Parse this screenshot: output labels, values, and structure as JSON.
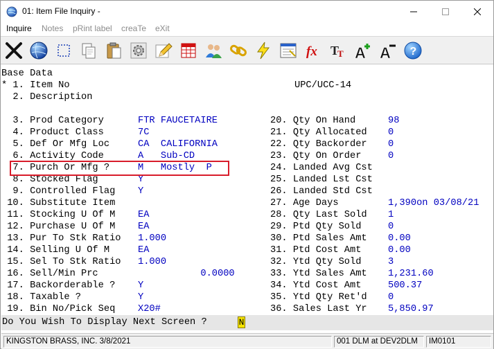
{
  "window": {
    "title": "01: Item File Inquiry -"
  },
  "menu": [
    {
      "label": "Inquire",
      "enabled": true
    },
    {
      "label": "Notes",
      "enabled": false
    },
    {
      "label": "pRint label",
      "enabled": false
    },
    {
      "label": "creaTe",
      "enabled": false
    },
    {
      "label": "eXit",
      "enabled": false
    }
  ],
  "toolbar": [
    "cancel-x-icon",
    "globe-icon",
    "select-rectangle-icon",
    "copy-pages-icon",
    "clipboard-icon",
    "gear-icon",
    "pencil-edit-icon",
    "spreadsheet-icon",
    "users-icon",
    "chain-link-icon",
    "lightning-icon",
    "calculator-window-icon",
    "fx-formula-icon",
    "font-size-icon",
    "increase-font-icon",
    "decrease-font-icon",
    "help-icon"
  ],
  "terminal": {
    "section_title": "Base Data",
    "left_fields": [
      {
        "label": "* 1. Item No",
        "value": ""
      },
      {
        "label": "  2. Description",
        "value": ""
      },
      {
        "label": "",
        "value": ""
      },
      {
        "label": "  3. Prod Category",
        "value": "FTR FAUCETAIRE"
      },
      {
        "label": "  4. Product Class",
        "value": "7C"
      },
      {
        "label": "  5. Def Or Mfg Loc",
        "value": "CA  CALIFORNIA"
      },
      {
        "label": "  6. Activity Code",
        "value": "A   Sub-CD"
      },
      {
        "label": "  7. Purch Or Mfg ?",
        "value": "M   Mostly  P"
      },
      {
        "label": "  8. Stocked Flag",
        "value": "Y"
      },
      {
        "label": "  9. Controlled Flag",
        "value": "Y"
      },
      {
        "label": " 10. Substitute Item",
        "value": ""
      },
      {
        "label": " 11. Stocking U Of M",
        "value": "EA"
      },
      {
        "label": " 12. Purchase U Of M",
        "value": "EA"
      },
      {
        "label": " 13. Pur To Stk Ratio",
        "value": "1.000"
      },
      {
        "label": " 14. Selling U Of M",
        "value": "EA"
      },
      {
        "label": " 15. Sel To Stk Ratio",
        "value": "1.000"
      },
      {
        "label": " 16. Sell/Min Prc",
        "value": "           0.0000"
      },
      {
        "label": " 17. Backorderable ?",
        "value": "Y"
      },
      {
        "label": " 18. Taxable ?",
        "value": "Y"
      },
      {
        "label": " 19. Bin No/Pick Seq",
        "value": "X20#"
      }
    ],
    "upc_label": "UPC/UCC-14",
    "right_fields": [
      {
        "label": "20. Qty On Hand",
        "value": "98"
      },
      {
        "label": "21. Qty Allocated",
        "value": "0"
      },
      {
        "label": "22. Qty Backorder",
        "value": "0"
      },
      {
        "label": "23. Qty On Order",
        "value": "0"
      },
      {
        "label": "24. Landed Avg Cst",
        "value": ""
      },
      {
        "label": "25. Landed Lst Cst",
        "value": ""
      },
      {
        "label": "26. Landed Std Cst",
        "value": ""
      },
      {
        "label": "27. Age Days",
        "value": "1,390on 03/08/21"
      },
      {
        "label": "28. Qty Last Sold",
        "value": "1"
      },
      {
        "label": "29. Ptd Qty Sold",
        "value": "0"
      },
      {
        "label": "30. Ptd Sales Amt",
        "value": "0.00"
      },
      {
        "label": "31. Ptd Cost Amt",
        "value": "0.00"
      },
      {
        "label": "32. Ytd Qty Sold",
        "value": "3"
      },
      {
        "label": "33. Ytd Sales Amt",
        "value": "1,231.60"
      },
      {
        "label": "34. Ytd Cost Amt",
        "value": "500.37"
      },
      {
        "label": "35. Ytd Qty Ret'd",
        "value": "0"
      },
      {
        "label": "36. Sales Last Yr",
        "value": "5,850.97"
      }
    ]
  },
  "prompt": {
    "text": "Do You Wish To Display Next Screen ?",
    "value": "N"
  },
  "status": {
    "company": "KINGSTON BRASS, INC. 3/8/2021",
    "session": "001 DLM at DEV2DLM",
    "program": "IM0101"
  },
  "colors": {
    "field_value": "#0000c0",
    "highlight": "#d81c2a",
    "prompt_input": "#f6e400"
  }
}
